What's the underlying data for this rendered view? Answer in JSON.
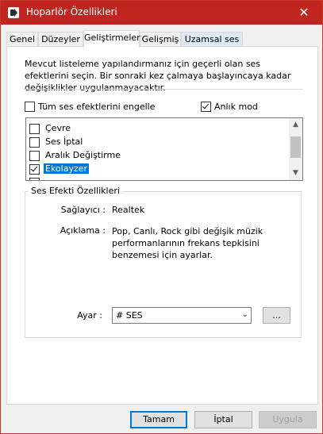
{
  "window": {
    "title": "Hoparlör Özellikleri",
    "close_glyph": "✕",
    "accent_color": "#c0251f"
  },
  "tabs": [
    {
      "label": "Genel"
    },
    {
      "label": "Düzeyler"
    },
    {
      "label": "Geliştirmeler"
    },
    {
      "label": "Gelişmiş"
    },
    {
      "label": "Uzamsal ses"
    }
  ],
  "description": "Mevcut listeleme yapılandırmanız için geçerli olan ses efektlerini seçin. Bir sonraki kez çalmaya başlayıncaya kadar değişiklikler uygulanmayacaktır.",
  "disable_all": {
    "label": "Tüm ses efektlerini engelle",
    "checked": false
  },
  "immediate_mode": {
    "label": "Anlık mod",
    "checked": true
  },
  "effects": [
    {
      "label": "Çevre",
      "checked": false
    },
    {
      "label": "Ses İptal",
      "checked": false
    },
    {
      "label": "Aralık Değiştirme",
      "checked": false
    },
    {
      "label": "Ekolayzer",
      "checked": true,
      "selected": true
    }
  ],
  "properties": {
    "group_title": "Ses Efekti Özellikleri",
    "provider_label": "Sağlayıcı :",
    "provider_value": "Realtek",
    "description_label": "Açıklama :",
    "description_value": "Pop, Canlı, Rock gibi değişik müzik performanlarının frekans tepkisini benzemesi için ayarlar.",
    "setting_label": "Ayar :",
    "setting_value": "# SES",
    "more_button": "..."
  },
  "buttons": {
    "ok": "Tamam",
    "cancel": "İptal",
    "apply": "Uygula"
  }
}
